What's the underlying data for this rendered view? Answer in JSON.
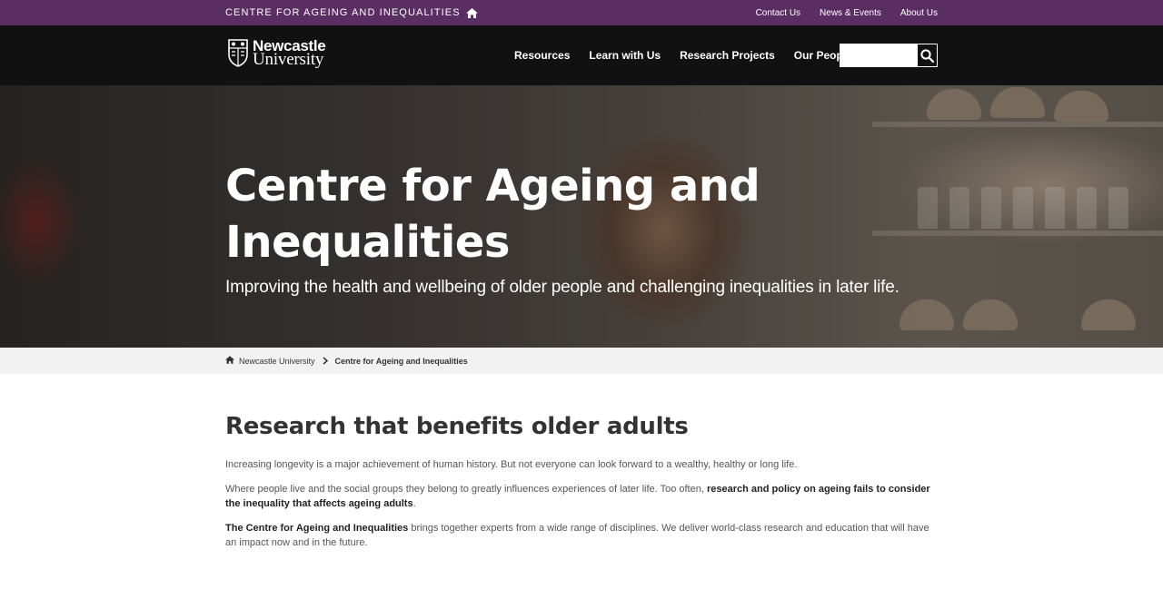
{
  "topbar": {
    "site_name": "Centre for Ageing and Inequalities",
    "home_icon": "home-icon",
    "links": [
      "Contact Us",
      "News & Events",
      "About Us"
    ]
  },
  "nav": {
    "logo_line1": "Newcastle",
    "logo_line2": "University",
    "items": [
      "Resources",
      "Learn with Us",
      "Research Projects",
      "Our People"
    ],
    "search_placeholder": "",
    "search_icon": "search-icon"
  },
  "hero": {
    "title": "Centre for Ageing and Inequalities",
    "subtitle": "Improving the health and wellbeing of older people and challenging inequalities in later life."
  },
  "breadcrumb": {
    "home": "Newcastle University",
    "current": "Centre for Ageing and Inequalities"
  },
  "content": {
    "heading": "Research that benefits older adults",
    "p1": "Increasing longevity is a major achievement of human history. But not everyone can look forward to a wealthy, healthy or long life.",
    "p2_start": "Where people live and the social groups they belong to greatly influences experiences of later life. Too often, ",
    "p2_bold": "research and policy on ageing fails to consider the inequality that affects ageing adults",
    "p2_end": ".",
    "p3_bold": "The Centre for Ageing and Inequalities",
    "p3_rest": " brings together experts from a wide range of disciplines. We deliver world-class research and education that will have an impact now and in the future."
  },
  "colors": {
    "topbar": "#5b2e63",
    "nav": "#111111",
    "breadcrumb_bg": "#f2f2f2"
  }
}
